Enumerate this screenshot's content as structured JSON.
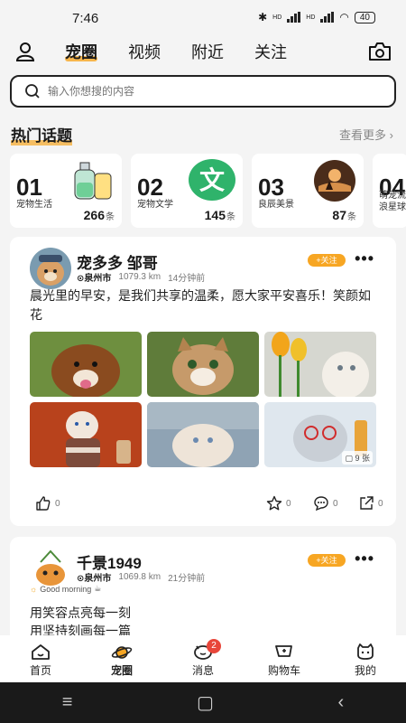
{
  "status": {
    "time": "7:46",
    "battery": "40",
    "net1": "HD",
    "net2": "HD"
  },
  "nav": {
    "tabs": [
      "宠圈",
      "视频",
      "附近",
      "关注"
    ],
    "active": 0
  },
  "search": {
    "placeholder": "输入你想搜的内容"
  },
  "hot": {
    "title": "热门话题",
    "see_more": "查看更多",
    "topics": [
      {
        "num": "01",
        "name": "宠物生活",
        "count": "266",
        "unit": "条"
      },
      {
        "num": "02",
        "name": "宠物文学",
        "count": "145",
        "unit": "条",
        "glyph": "文"
      },
      {
        "num": "03",
        "name": "良辰美景",
        "count": "87",
        "unit": "条"
      },
      {
        "num": "04",
        "name": "萌宠流浪星球",
        "count": "",
        "unit": ""
      }
    ]
  },
  "post1": {
    "username": "宠多多 邹哥",
    "city": "泉州市",
    "distance": "1079.3 km",
    "time": "14分钟前",
    "follow": "+关注",
    "text": "晨光里的早安，是我们共享的温柔，愿大家平安喜乐！笑颜如花",
    "photo_count": "9 张",
    "likes": "0",
    "stars": "0",
    "comments": "0",
    "shares": "0"
  },
  "post2": {
    "username": "千景1949",
    "city": "泉州市",
    "distance": "1069.8 km",
    "time": "21分钟前",
    "follow": "+关注",
    "mood": "Good morning",
    "lines": [
      "用笑容点亮每一刻",
      "用坚持刻画每一篇"
    ]
  },
  "bottom": {
    "items": [
      "首页",
      "宠圈",
      "消息",
      "购物车",
      "我的"
    ],
    "active": 1,
    "message_badge": "2"
  },
  "colors": {
    "accent": "#f7a623",
    "badge": "#e8463a",
    "green": "#2fb36b"
  }
}
